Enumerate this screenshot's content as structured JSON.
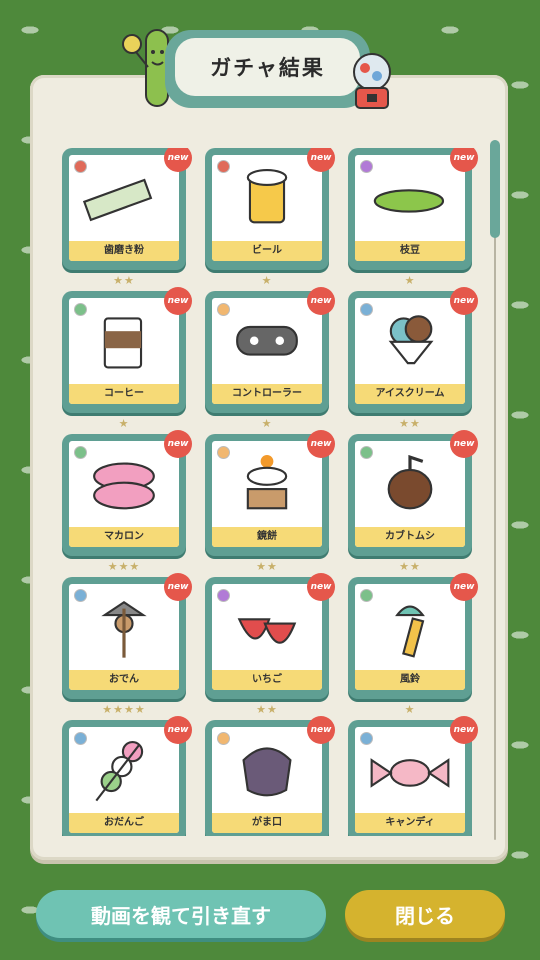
{
  "header": {
    "title": "ガチャ結果"
  },
  "new_badge": "new",
  "items": [
    {
      "label": "歯磨き粉",
      "stars": "★★",
      "rarity": "#e06b5a"
    },
    {
      "label": "ビール",
      "stars": "★",
      "rarity": "#e06b5a"
    },
    {
      "label": "枝豆",
      "stars": "★",
      "rarity": "#b17ad6"
    },
    {
      "label": "コーヒー",
      "stars": "★",
      "rarity": "#7cc08a"
    },
    {
      "label": "コントローラー",
      "stars": "★",
      "rarity": "#f1b770"
    },
    {
      "label": "アイスクリーム",
      "stars": "★★",
      "rarity": "#7ab0d6"
    },
    {
      "label": "マカロン",
      "stars": "★★★",
      "rarity": "#7cc08a"
    },
    {
      "label": "鏡餅",
      "stars": "★★",
      "rarity": "#f1b770"
    },
    {
      "label": "カブトムシ",
      "stars": "★★",
      "rarity": "#7cc08a"
    },
    {
      "label": "おでん",
      "stars": "★★★★",
      "rarity": "#7ab0d6"
    },
    {
      "label": "いちご",
      "stars": "★★",
      "rarity": "#b17ad6"
    },
    {
      "label": "風鈴",
      "stars": "★",
      "rarity": "#7cc08a"
    },
    {
      "label": "おだんご",
      "stars": "",
      "rarity": "#7ab0d6"
    },
    {
      "label": "がま口",
      "stars": "",
      "rarity": "#f1b770"
    },
    {
      "label": "キャンディ",
      "stars": "",
      "rarity": "#7ab0d6"
    }
  ],
  "buttons": {
    "watch_video": "動画を観て引き直す",
    "close": "閉じる"
  },
  "colors": {
    "background": "#4e893b",
    "panel": "#efece0",
    "card": "#5f9f93",
    "label": "#f6da77",
    "new_badge": "#e5574b",
    "video_button": "#6fc3b3",
    "close_button": "#d5b32e"
  }
}
